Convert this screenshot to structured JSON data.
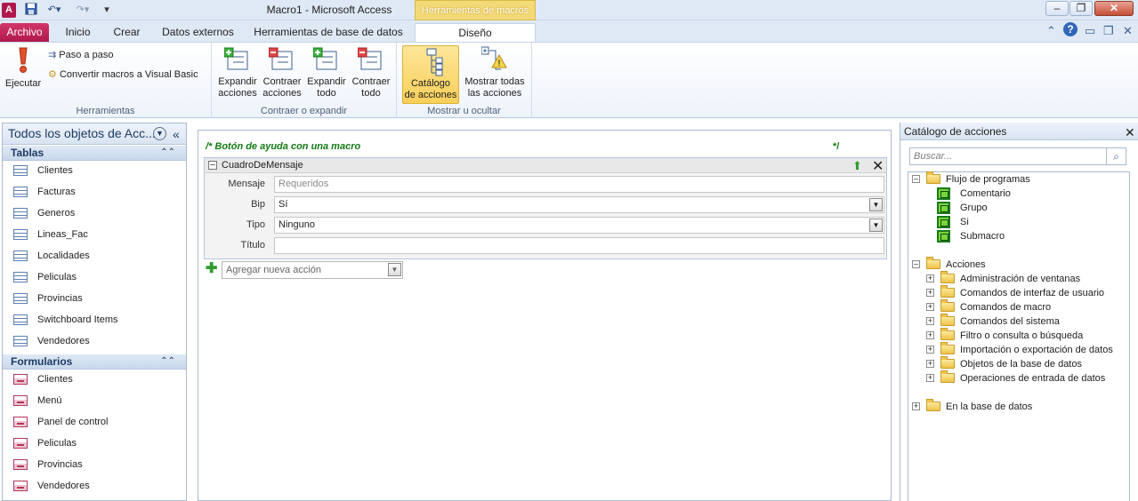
{
  "window": {
    "title": "Macro1  -  Microsoft Access",
    "context_tab_group": "Herramientas de macros"
  },
  "ribbon_tabs": {
    "archivo": "Archivo",
    "inicio": "Inicio",
    "crear": "Crear",
    "datos_externos": "Datos externos",
    "herramientas_bd": "Herramientas de base de datos",
    "diseno": "Diseño"
  },
  "ribbon": {
    "groups": {
      "herramientas": "Herramientas",
      "contraer": "Contraer o expandir",
      "mostrar": "Mostrar u ocultar"
    },
    "buttons": {
      "ejecutar": "Ejecutar",
      "paso_a_paso": "Paso a paso",
      "convertir": "Convertir macros a Visual Basic",
      "expandir_acciones_1": "Expandir",
      "expandir_acciones_2": "acciones",
      "contraer_acciones_1": "Contraer",
      "contraer_acciones_2": "acciones",
      "expandir_todo_1": "Expandir",
      "expandir_todo_2": "todo",
      "contraer_todo_1": "Contraer",
      "contraer_todo_2": "todo",
      "catalogo_1": "Catálogo",
      "catalogo_2": "de acciones",
      "mostrar_todas_1": "Mostrar todas",
      "mostrar_todas_2": "las acciones"
    }
  },
  "nav": {
    "header": "Todos los objetos de Acc...",
    "sections": {
      "tablas": {
        "label": "Tablas",
        "items": [
          "Clientes",
          "Facturas",
          "Generos",
          "Lineas_Fac",
          "Localidades",
          "Peliculas",
          "Provincias",
          "Switchboard Items",
          "Vendedores"
        ]
      },
      "formularios": {
        "label": "Formularios",
        "items": [
          "Clientes",
          "Menú",
          "Panel de control",
          "Peliculas",
          "Provincias",
          "Vendedores"
        ]
      }
    }
  },
  "editor": {
    "comment_start": "/*   Botón de ayuda con una macro",
    "comment_end": "*/",
    "action": {
      "name": "CuadroDeMensaje",
      "args": [
        {
          "label": "Mensaje",
          "value": "Requeridos"
        },
        {
          "label": "Bip",
          "value": "Sí"
        },
        {
          "label": "Tipo",
          "value": "Ninguno"
        },
        {
          "label": "Título",
          "value": ""
        }
      ]
    },
    "add_action": "Agregar nueva acción"
  },
  "catalog": {
    "title": "Catálogo de acciones",
    "search_placeholder": "Buscar...",
    "flujo": {
      "label": "Flujo de programas",
      "items": [
        "Comentario",
        "Grupo",
        "Si",
        "Submacro"
      ]
    },
    "acciones": {
      "label": "Acciones",
      "items": [
        "Administración de ventanas",
        "Comandos de interfaz de usuario",
        "Comandos de macro",
        "Comandos del sistema",
        "Filtro o consulta o búsqueda",
        "Importación o exportación de datos",
        "Objetos de la base de datos",
        "Operaciones de entrada de datos"
      ]
    },
    "en_bd": "En la base de datos"
  }
}
